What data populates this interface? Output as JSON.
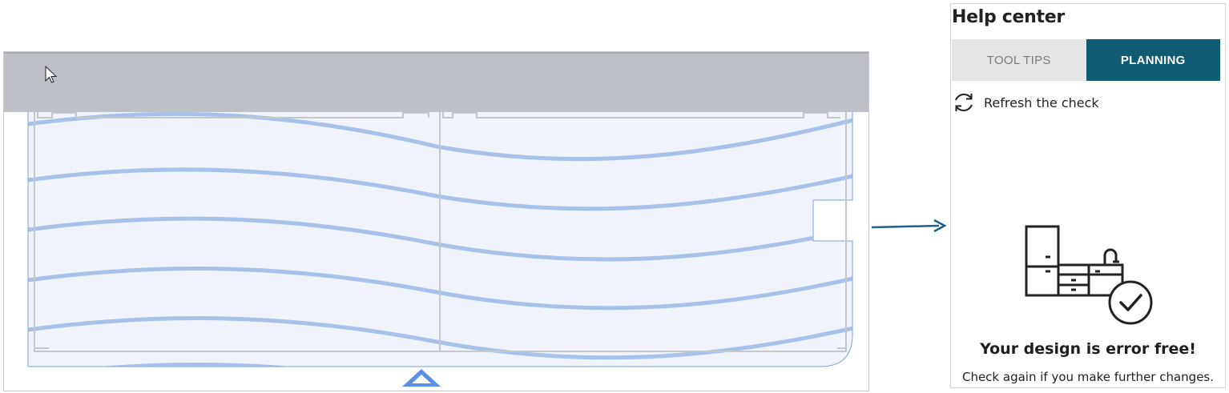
{
  "help_center": {
    "title": "Help center",
    "tabs": [
      {
        "label": "TOOL TIPS",
        "active": false
      },
      {
        "label": "PLANNING",
        "active": true
      }
    ],
    "refresh_label": "Refresh the check",
    "status_title": "Your design is error free!",
    "status_subtitle": "Check again if you make further changes."
  },
  "colors": {
    "accent": "#0f5b73",
    "tab_inactive_bg": "#e4e5e7",
    "canvas_topbar": "#bdc0c6",
    "grain": "#8fb0e4",
    "connector_arrow": "#1f5f8b",
    "scroll_handle": "#5b8fe3"
  },
  "icons": {
    "refresh": "refresh-icon",
    "illustration": "kitchen-check-icon",
    "cursor": "cursor-icon"
  }
}
